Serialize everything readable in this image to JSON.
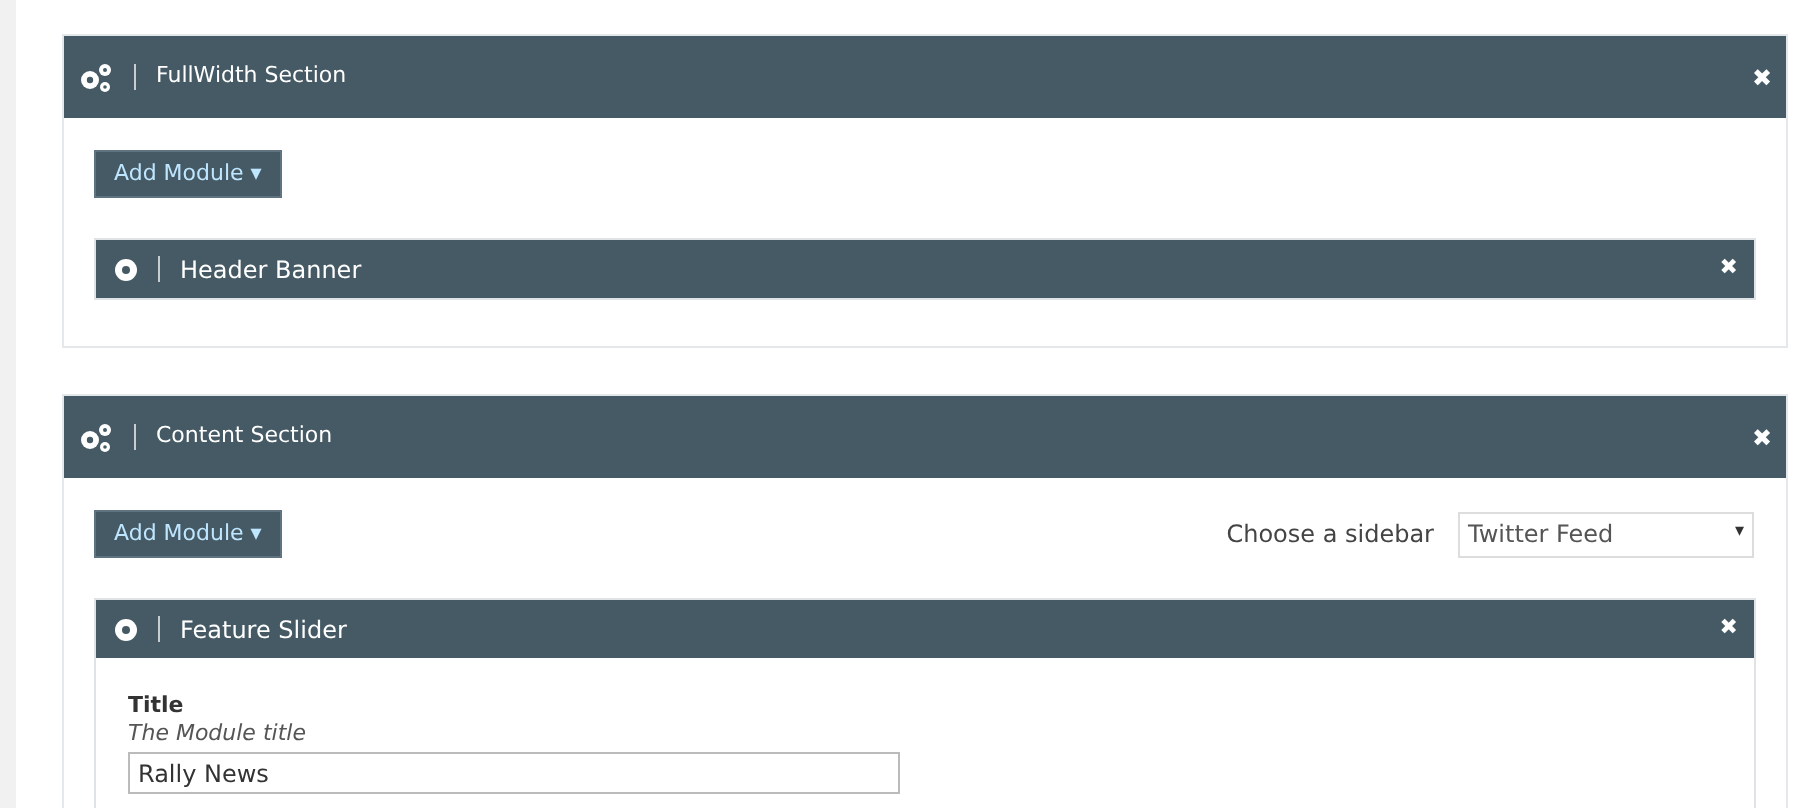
{
  "sections": [
    {
      "title": "FullWidth Section",
      "add_button": "Add Module ▾",
      "modules": [
        {
          "title": "Header Banner",
          "close": "✖"
        }
      ],
      "close": "✖"
    },
    {
      "title": "Content Section",
      "add_button": "Add Module ▾",
      "sidebar": {
        "label": "Choose a sidebar",
        "value": "Twitter Feed",
        "caret": "▾"
      },
      "modules": [
        {
          "title": "Feature Slider",
          "close": "✖",
          "fields": [
            {
              "label": "Title",
              "description": "The Module title",
              "value": "Rally News"
            }
          ]
        }
      ],
      "close": "✖"
    }
  ]
}
